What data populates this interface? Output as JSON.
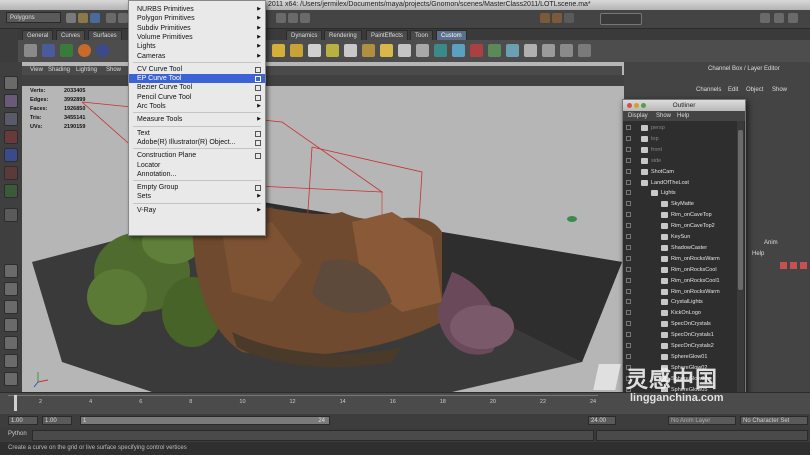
{
  "window": {
    "title": "2011 x64: /Users/jermilex/Documents/maya/projects/Gnomon/scenes/MasterClass2011/LOTLscene.ma*"
  },
  "menuset": {
    "value": "Polygons"
  },
  "shelf": {
    "tabs": [
      "General",
      "Curves",
      "Surfaces",
      "Dynamics",
      "Rendering",
      "PaintEffects",
      "Toon",
      "Custom"
    ],
    "active_tab": "Custom"
  },
  "viewport": {
    "menu": [
      "View",
      "Shading",
      "Lighting",
      "Show"
    ],
    "hud": [
      {
        "label": "Verts:",
        "value": "2033405"
      },
      {
        "label": "Edges:",
        "value": "3992899"
      },
      {
        "label": "Faces:",
        "value": "1926850"
      },
      {
        "label": "Tris:",
        "value": "3455141"
      },
      {
        "label": "UVs:",
        "value": "2190159"
      }
    ]
  },
  "dropdown": {
    "items": [
      {
        "label": "NURBS Primitives",
        "arrow": true
      },
      {
        "label": "Polygon Primitives",
        "arrow": true
      },
      {
        "label": "Subdiv Primitives",
        "arrow": true
      },
      {
        "label": "Volume Primitives",
        "arrow": true
      },
      {
        "label": "Lights",
        "arrow": true
      },
      {
        "label": "Cameras",
        "arrow": true
      },
      {
        "label": "CV Curve Tool",
        "box": true
      },
      {
        "label": "EP Curve Tool",
        "box": true,
        "highlight": true
      },
      {
        "label": "Bezier Curve Tool",
        "box": true
      },
      {
        "label": "Pencil Curve Tool",
        "box": true
      },
      {
        "label": "Arc Tools",
        "arrow": true
      },
      {
        "label": "Measure Tools",
        "arrow": true
      },
      {
        "label": "Text",
        "box": true
      },
      {
        "label": "Adobe(R) Illustrator(R) Object...",
        "box": true
      },
      {
        "label": "Construction Plane",
        "box": true
      },
      {
        "label": "Locator"
      },
      {
        "label": "Annotation..."
      },
      {
        "label": "Empty Group",
        "box": true
      },
      {
        "label": "Sets",
        "arrow": true
      },
      {
        "label": "V-Ray",
        "arrow": true
      }
    ]
  },
  "channel_box": {
    "title": "Channel Box / Layer Editor",
    "menu": [
      "Channels",
      "Edit",
      "Object",
      "Show"
    ],
    "layer_tab": "Anim",
    "help": "Help"
  },
  "outliner": {
    "title": "Outliner",
    "menu": [
      "Display",
      "Show",
      "Help"
    ],
    "items": [
      {
        "label": "persp",
        "dim": true,
        "indent": 0
      },
      {
        "label": "top",
        "dim": true,
        "indent": 0
      },
      {
        "label": "front",
        "dim": true,
        "indent": 0
      },
      {
        "label": "side",
        "dim": true,
        "indent": 0
      },
      {
        "label": "ShotCam",
        "indent": 0
      },
      {
        "label": "LandOfTheLost",
        "indent": 0
      },
      {
        "label": "Lights",
        "indent": 1
      },
      {
        "label": "SkyMatte",
        "indent": 2
      },
      {
        "label": "Rim_onCaveTop",
        "indent": 2
      },
      {
        "label": "Rim_onCaveTop2",
        "indent": 2
      },
      {
        "label": "KeySun",
        "indent": 2
      },
      {
        "label": "ShadowCaster",
        "indent": 2
      },
      {
        "label": "Rim_onRocksWarm",
        "indent": 2
      },
      {
        "label": "Rim_onRocksCool",
        "indent": 2
      },
      {
        "label": "Rim_onRocksCool1",
        "indent": 2
      },
      {
        "label": "Rim_onRocksWarm",
        "indent": 2
      },
      {
        "label": "CrystalLights",
        "indent": 2
      },
      {
        "label": "KickOnLogo",
        "indent": 2
      },
      {
        "label": "SpecOnCrystals",
        "indent": 2
      },
      {
        "label": "SpecOnCrystals1",
        "indent": 2
      },
      {
        "label": "SpecOnCrystals2",
        "indent": 2
      },
      {
        "label": "SphereGlow01",
        "indent": 2
      },
      {
        "label": "SphereGlow02",
        "indent": 2
      },
      {
        "label": "SphereGlow03",
        "indent": 2
      },
      {
        "label": "SphereGlow05",
        "indent": 2
      }
    ]
  },
  "timeline": {
    "ticks": [
      "1",
      "2",
      "4",
      "6",
      "8",
      "10",
      "12",
      "14",
      "16",
      "18",
      "20",
      "22",
      "24"
    ],
    "start": "1.00",
    "range_start": "1.00",
    "range_current": "1",
    "range_end": "24",
    "end": "24.00",
    "layer": "No Anim Layer",
    "character": "No Character Set"
  },
  "command_line": {
    "label": "Python"
  },
  "help_line": {
    "text": "Create a curve on the grid or live surface specifying control vertices"
  },
  "watermark": {
    "cn": "灵感中国",
    "url": "lingganchina.com"
  }
}
